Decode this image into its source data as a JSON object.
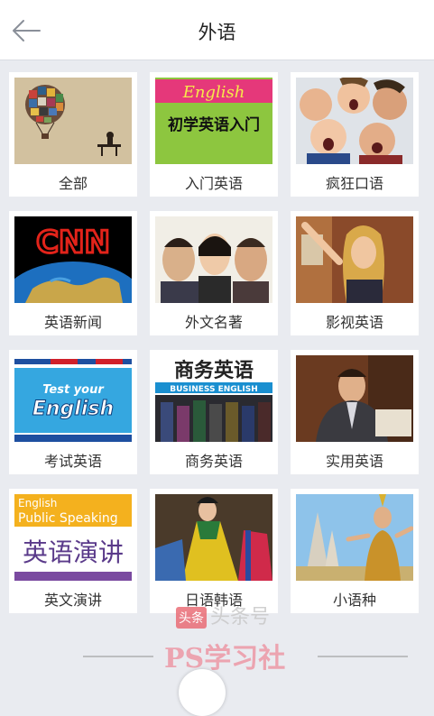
{
  "header": {
    "title": "外语"
  },
  "tiles": [
    {
      "label": "全部",
      "icon": "balloon-illustration"
    },
    {
      "label": "入门英语",
      "icon": "beginner-english-cover",
      "cover_top": "English",
      "cover_text": "初学英语入门"
    },
    {
      "label": "疯狂口语",
      "icon": "shouting-people-photo"
    },
    {
      "label": "英语新闻",
      "icon": "cnn-globe",
      "cover_text": "CNN"
    },
    {
      "label": "外文名著",
      "icon": "classic-film-poster"
    },
    {
      "label": "影视英语",
      "icon": "actress-photo"
    },
    {
      "label": "考试英语",
      "icon": "test-your-english-cover",
      "cover_text": "Test your English"
    },
    {
      "label": "商务英语",
      "icon": "business-english-cover",
      "cover_top": "商务英语",
      "cover_text": "BUSINESS ENGLISH"
    },
    {
      "label": "实用英语",
      "icon": "businessman-photo"
    },
    {
      "label": "英文演讲",
      "icon": "public-speaking-cover",
      "cover_top": "English Public Speaking",
      "cover_text": "英语演讲"
    },
    {
      "label": "日语韩语",
      "icon": "korean-dress-photo"
    },
    {
      "label": "小语种",
      "icon": "thai-dancer-photo"
    }
  ],
  "watermark": {
    "badge": "头条",
    "line1": "头条号",
    "line2": "PS学习社"
  },
  "colors": {
    "header_bg": "#ffffff",
    "page_bg": "#e9ebf0",
    "tile_bg": "#ffffff"
  }
}
